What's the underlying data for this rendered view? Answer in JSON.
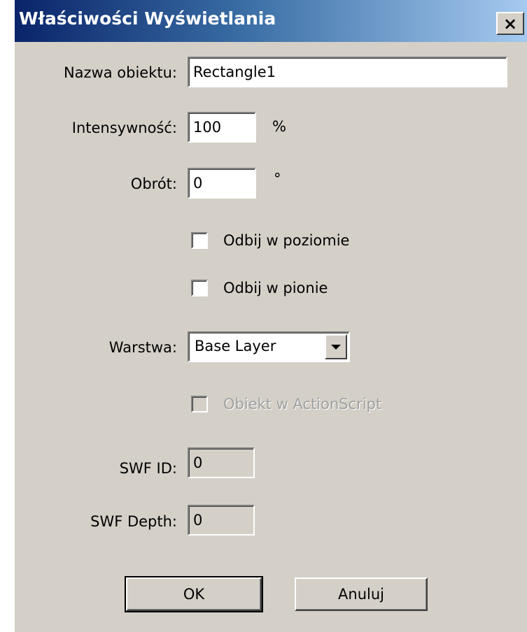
{
  "window": {
    "title": "Właściwości Wyświetlania",
    "close_label": "×"
  },
  "fields": {
    "object_name": {
      "label": "Nazwa obiektu:",
      "value": "Rectangle1"
    },
    "intensity": {
      "label": "Intensywność:",
      "value": "100",
      "unit": "%"
    },
    "rotation": {
      "label": "Obrót:",
      "value": "0",
      "unit": "°"
    },
    "flip_horizontal": {
      "label": "Odbij w poziomie",
      "checked": false
    },
    "flip_vertical": {
      "label": "Odbij w pionie",
      "checked": false
    },
    "layer": {
      "label": "Warstwa:",
      "selected": "Base Layer"
    },
    "actionscript": {
      "label": "Obiekt w ActionScript",
      "checked": false,
      "disabled": true
    },
    "swf_id": {
      "label": "SWF ID:",
      "value": "0"
    },
    "swf_depth": {
      "label": "SWF Depth:",
      "value": "0"
    }
  },
  "buttons": {
    "ok": "OK",
    "cancel": "Anuluj"
  }
}
